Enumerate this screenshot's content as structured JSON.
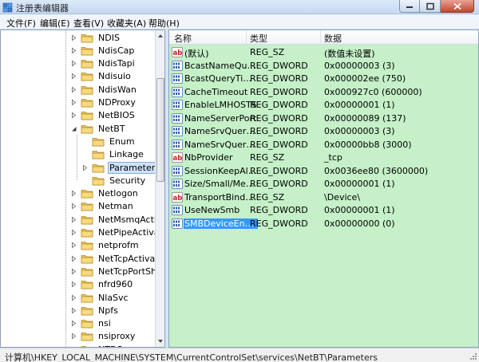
{
  "window": {
    "title": "注册表编辑器",
    "icon": "regedit-icon"
  },
  "menu": [
    "文件(F)",
    "编辑(E)",
    "查看(V)",
    "收藏夹(A)",
    "帮助(H)"
  ],
  "tree": {
    "items": [
      {
        "label": "NDIS",
        "expander": "collapsed"
      },
      {
        "label": "NdisCap",
        "expander": "collapsed"
      },
      {
        "label": "NdisTapi",
        "expander": "collapsed"
      },
      {
        "label": "Ndisuio",
        "expander": "collapsed"
      },
      {
        "label": "NdisWan",
        "expander": "collapsed"
      },
      {
        "label": "NDProxy",
        "expander": "collapsed"
      },
      {
        "label": "NetBIOS",
        "expander": "collapsed"
      },
      {
        "label": "NetBT",
        "expander": "expanded"
      },
      {
        "label": "Enum",
        "expander": "none"
      },
      {
        "label": "Linkage",
        "expander": "none"
      },
      {
        "label": "Parameters",
        "expander": "collapsed",
        "selected": true
      },
      {
        "label": "Security",
        "expander": "none"
      },
      {
        "label": "Netlogon",
        "expander": "collapsed"
      },
      {
        "label": "Netman",
        "expander": "collapsed"
      },
      {
        "label": "NetMsmqActivator",
        "expander": "collapsed"
      },
      {
        "label": "NetPipeActivator",
        "expander": "collapsed"
      },
      {
        "label": "netprofm",
        "expander": "collapsed"
      },
      {
        "label": "NetTcpActivator",
        "expander": "collapsed"
      },
      {
        "label": "NetTcpPortSharing",
        "expander": "collapsed"
      },
      {
        "label": "nfrd960",
        "expander": "collapsed"
      },
      {
        "label": "NlaSvc",
        "expander": "collapsed"
      },
      {
        "label": "Npfs",
        "expander": "collapsed"
      },
      {
        "label": "nsi",
        "expander": "collapsed"
      },
      {
        "label": "nsiproxy",
        "expander": "collapsed"
      },
      {
        "label": "NTDS",
        "expander": "collapsed"
      }
    ]
  },
  "list": {
    "columns": [
      "名称",
      "类型",
      "数据"
    ],
    "rows": [
      {
        "name": "(默认)",
        "type": "REG_SZ",
        "data": "(数值未设置)",
        "icon": "string-value-icon"
      },
      {
        "name": "BcastNameQueryCount",
        "type": "REG_DWORD",
        "data": "0x00000003 (3)",
        "icon": "binary-value-icon"
      },
      {
        "name": "BcastQueryTimeout",
        "type": "REG_DWORD",
        "data": "0x000002ee (750)",
        "icon": "binary-value-icon"
      },
      {
        "name": "CacheTimeout",
        "type": "REG_DWORD",
        "data": "0x000927c0 (600000)",
        "icon": "binary-value-icon"
      },
      {
        "name": "EnableLMHOSTS",
        "type": "REG_DWORD",
        "data": "0x00000001 (1)",
        "icon": "binary-value-icon"
      },
      {
        "name": "NameServerPort",
        "type": "REG_DWORD",
        "data": "0x00000089 (137)",
        "icon": "binary-value-icon"
      },
      {
        "name": "NameSrvQueryCount",
        "type": "REG_DWORD",
        "data": "0x00000003 (3)",
        "icon": "binary-value-icon"
      },
      {
        "name": "NameSrvQueryTimeout",
        "type": "REG_DWORD",
        "data": "0x00000bb8 (3000)",
        "icon": "binary-value-icon"
      },
      {
        "name": "NbProvider",
        "type": "REG_SZ",
        "data": "_tcp",
        "icon": "string-value-icon"
      },
      {
        "name": "SessionKeepAlive",
        "type": "REG_DWORD",
        "data": "0x0036ee80 (3600000)",
        "icon": "binary-value-icon"
      },
      {
        "name": "Size/Small/Medium/Large",
        "type": "REG_DWORD",
        "data": "0x00000001 (1)",
        "icon": "binary-value-icon"
      },
      {
        "name": "TransportBindName",
        "type": "REG_SZ",
        "data": "\\Device\\",
        "icon": "string-value-icon"
      },
      {
        "name": "UseNewSmb",
        "type": "REG_DWORD",
        "data": "0x00000001 (1)",
        "icon": "binary-value-icon"
      },
      {
        "name": "SMBDeviceEnabled",
        "type": "REG_DWORD",
        "data": "0x00000000 (0)",
        "icon": "binary-value-icon",
        "selected": true
      }
    ]
  },
  "status": {
    "path": "计算机\\HKEY_LOCAL_MACHINE\\SYSTEM\\CurrentControlSet\\services\\NetBT\\Parameters"
  },
  "colors": {
    "list_background": "#c5f0c8",
    "selection": "#3399ff",
    "folder": "#e9c35a"
  }
}
